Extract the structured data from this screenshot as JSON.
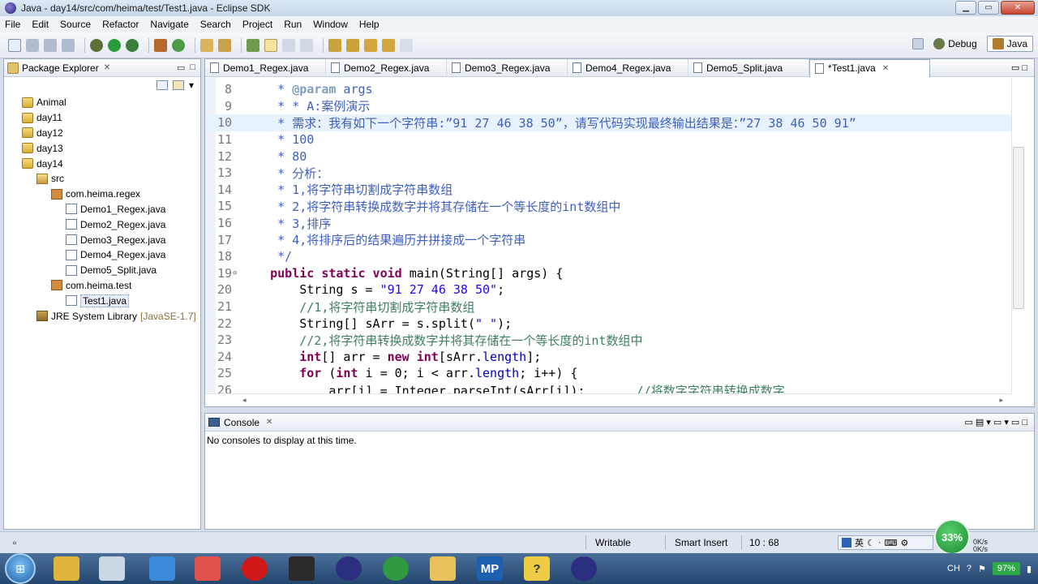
{
  "window": {
    "title": "Java - day14/src/com/heima/test/Test1.java - Eclipse SDK",
    "min": "▁",
    "max": "▭",
    "close": "✕"
  },
  "menu": [
    "File",
    "Edit",
    "Source",
    "Refactor",
    "Navigate",
    "Search",
    "Project",
    "Run",
    "Window",
    "Help"
  ],
  "perspective": {
    "debug": "Debug",
    "java": "Java"
  },
  "package_explorer": {
    "title": "Package Explorer",
    "close": "✕",
    "minimize": "▭",
    "maximize": "□",
    "tree": [
      {
        "label": "Animal",
        "level": 0,
        "type": "project"
      },
      {
        "label": "day11",
        "level": 0,
        "type": "project"
      },
      {
        "label": "day12",
        "level": 0,
        "type": "project"
      },
      {
        "label": "day13",
        "level": 0,
        "type": "project"
      },
      {
        "label": "day14",
        "level": 0,
        "type": "project"
      },
      {
        "label": "src",
        "level": 1,
        "type": "src"
      },
      {
        "label": "com.heima.regex",
        "level": 2,
        "type": "pkg"
      },
      {
        "label": "Demo1_Regex.java",
        "level": 3,
        "type": "java"
      },
      {
        "label": "Demo2_Regex.java",
        "level": 3,
        "type": "java"
      },
      {
        "label": "Demo3_Regex.java",
        "level": 3,
        "type": "java"
      },
      {
        "label": "Demo4_Regex.java",
        "level": 3,
        "type": "java"
      },
      {
        "label": "Demo5_Split.java",
        "level": 3,
        "type": "java"
      },
      {
        "label": "com.heima.test",
        "level": 2,
        "type": "pkg"
      },
      {
        "label": "Test1.java",
        "level": 3,
        "type": "java",
        "selected": true
      },
      {
        "label": "JRE System Library",
        "level": 1,
        "type": "lib",
        "suffix": "[JavaSE-1.7]"
      }
    ]
  },
  "editor": {
    "tabs": [
      {
        "label": "Demo1_Regex.java",
        "active": false
      },
      {
        "label": "Demo2_Regex.java",
        "active": false
      },
      {
        "label": "Demo3_Regex.java",
        "active": false
      },
      {
        "label": "Demo4_Regex.java",
        "active": false
      },
      {
        "label": "Demo5_Split.java",
        "active": false
      },
      {
        "label": "*Test1.java",
        "active": true
      }
    ],
    "tab_close": "✕",
    "view_menu": "▭ □",
    "lines": [
      {
        "n": "8",
        "seg": [
          {
            "t": "     * ",
            "c": "com"
          },
          {
            "t": "@param",
            "c": "tag"
          },
          {
            "t": " args",
            "c": "com"
          }
        ]
      },
      {
        "n": "9",
        "seg": [
          {
            "t": "     * * A:案例演示",
            "c": "com"
          }
        ]
      },
      {
        "n": "10",
        "current": true,
        "seg": [
          {
            "t": "     * 需求：我有如下一个字符串:”91 27 46 38 50”，请写代码实现最终输出结果是：”27 38 46 50 91”",
            "c": "com"
          }
        ]
      },
      {
        "n": "11",
        "seg": [
          {
            "t": "     * 100",
            "c": "com"
          }
        ]
      },
      {
        "n": "12",
        "seg": [
          {
            "t": "     * 80",
            "c": "com"
          }
        ]
      },
      {
        "n": "13",
        "seg": [
          {
            "t": "     * 分析：",
            "c": "com"
          }
        ]
      },
      {
        "n": "14",
        "seg": [
          {
            "t": "     * 1,将字符串切割成字符串数组",
            "c": "com"
          }
        ]
      },
      {
        "n": "15",
        "seg": [
          {
            "t": "     * 2,将字符串转换成数字并将其存储在一个等长度的int数组中",
            "c": "com"
          }
        ]
      },
      {
        "n": "16",
        "seg": [
          {
            "t": "     * 3,排序",
            "c": "com"
          }
        ]
      },
      {
        "n": "17",
        "seg": [
          {
            "t": "     * 4,将排序后的结果遍历并拼接成一个字符串",
            "c": "com"
          }
        ]
      },
      {
        "n": "18",
        "seg": [
          {
            "t": "     */",
            "c": "com"
          }
        ]
      },
      {
        "n": "19",
        "fold": "⊖",
        "seg": [
          {
            "t": "    ",
            "c": ""
          },
          {
            "t": "public static void",
            "c": "kw"
          },
          {
            "t": " main(String[] args) {",
            "c": ""
          }
        ]
      },
      {
        "n": "20",
        "seg": [
          {
            "t": "        String s = ",
            "c": ""
          },
          {
            "t": "\"91 27 46 38 50\"",
            "c": "str"
          },
          {
            "t": ";",
            "c": ""
          }
        ]
      },
      {
        "n": "21",
        "seg": [
          {
            "t": "        //1,将字符串切割成字符串数组",
            "c": "lcom"
          }
        ]
      },
      {
        "n": "22",
        "seg": [
          {
            "t": "        String[] sArr = s.split(",
            "c": ""
          },
          {
            "t": "\" \"",
            "c": "str"
          },
          {
            "t": ");",
            "c": ""
          }
        ]
      },
      {
        "n": "23",
        "seg": [
          {
            "t": "        //2,将字符串转换成数字并将其存储在一个等长度的int数组中",
            "c": "lcom"
          }
        ]
      },
      {
        "n": "24",
        "seg": [
          {
            "t": "        ",
            "c": ""
          },
          {
            "t": "int",
            "c": "kw"
          },
          {
            "t": "[] arr = ",
            "c": ""
          },
          {
            "t": "new int",
            "c": "kw"
          },
          {
            "t": "[sArr.",
            "c": ""
          },
          {
            "t": "length",
            "c": "field"
          },
          {
            "t": "];",
            "c": ""
          }
        ]
      },
      {
        "n": "25",
        "seg": [
          {
            "t": "        ",
            "c": ""
          },
          {
            "t": "for",
            "c": "kw"
          },
          {
            "t": " (",
            "c": ""
          },
          {
            "t": "int",
            "c": "kw"
          },
          {
            "t": " i = 0; i < arr.",
            "c": ""
          },
          {
            "t": "length",
            "c": "field"
          },
          {
            "t": "; i++) {",
            "c": ""
          }
        ]
      },
      {
        "n": "26",
        "seg": [
          {
            "t": "            arr[i] = Integer.parseInt(sArr[i]);       ",
            "c": ""
          },
          {
            "t": "//将数字字符串转换成数字",
            "c": "lcom"
          }
        ]
      }
    ]
  },
  "console": {
    "title": "Console",
    "close": "✕",
    "tools": "▭  ▤ ▾  ▭ ▾  ▭ □",
    "message": "No consoles to display at this time."
  },
  "status": {
    "writable": "Writable",
    "insert_mode": "Smart Insert",
    "position": "10 : 68"
  },
  "ime": {
    "lang": "英"
  },
  "network": {
    "percent": "33%",
    "up": "0K/s",
    "down": "0K/s"
  },
  "tray": {
    "lang": "CH",
    "battery": "97%"
  },
  "taskbar_icons": [
    {
      "name": "ie-icon",
      "color": "#e0b43a"
    },
    {
      "name": "paint-icon",
      "color": "#c9d6e6"
    },
    {
      "name": "qq-icon",
      "color": "#3b8ad9"
    },
    {
      "name": "eraser-icon",
      "color": "#e0514a"
    },
    {
      "name": "opera-icon",
      "color": "#d01818"
    },
    {
      "name": "camera-icon",
      "color": "#2a2a2a"
    },
    {
      "name": "eclipse-icon",
      "color": "#2c2f80"
    },
    {
      "name": "chrome-icon",
      "color": "#2f9a3f"
    },
    {
      "name": "explorer-icon",
      "color": "#e8c15a"
    },
    {
      "name": "mp-icon",
      "color": "#1d5fb0"
    },
    {
      "name": "help-icon",
      "color": "#efcc45"
    },
    {
      "name": "eclipse2-icon",
      "color": "#2c2f80"
    }
  ],
  "taskbar_labels": {
    "mp": "MP",
    "help": "?"
  },
  "icons": {
    "start": "⊞",
    "chevron": "▾"
  },
  "colors": {
    "keyword": "#7f0055",
    "comment": "#3f5fbf",
    "string": "#2a00ff",
    "line_comment": "#3f7f5f",
    "current_line": "#e8f2fe"
  }
}
